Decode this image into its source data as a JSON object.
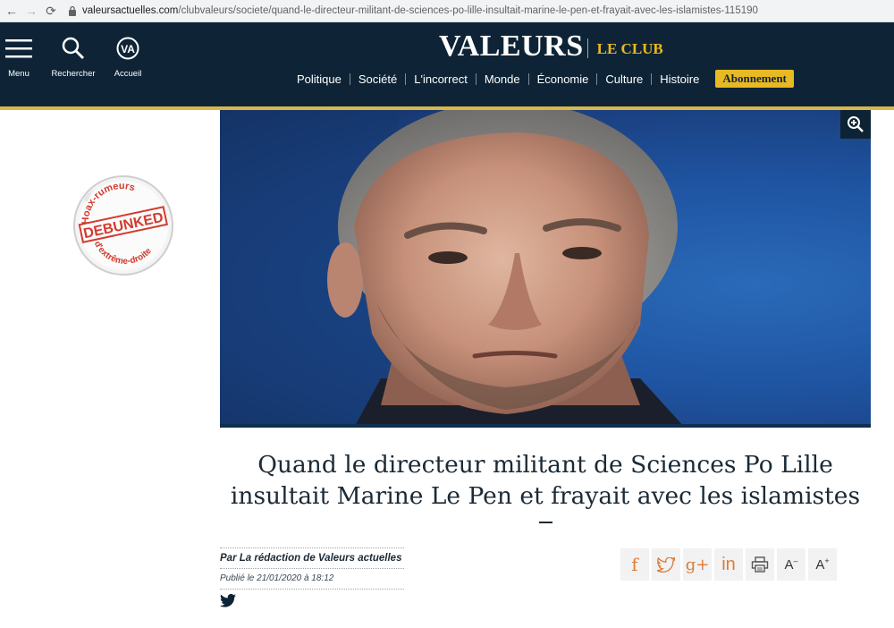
{
  "browser": {
    "url_host": "valeursactuelles.com",
    "url_path": "/clubvaleurs/societe/quand-le-directeur-militant-de-sciences-po-lille-insultait-marine-le-pen-et-frayait-avec-les-islamistes-115190"
  },
  "header": {
    "tools": [
      {
        "label": "Menu",
        "icon": "hamburger-icon"
      },
      {
        "label": "Rechercher",
        "icon": "search-icon"
      },
      {
        "label": "Accueil",
        "icon": "va-home-icon"
      }
    ],
    "logo": {
      "main": "VALEURS",
      "sub": "LE CLUB",
      "va_glyph": "VA"
    },
    "nav": [
      "Politique",
      "Société",
      "L'incorrect",
      "Monde",
      "Économie",
      "Culture",
      "Histoire"
    ],
    "subscribe": "Abonnement",
    "accent_color": "#e8b923",
    "background_color": "#0e2436"
  },
  "stamp": {
    "line_top": "Hoax-rumeurs",
    "line_middle": "DEBUNKED",
    "line_bottom": "d'extrême-droite",
    "color": "#d23b2e"
  },
  "hero": {
    "zoom_icon": "zoom-in-icon"
  },
  "article": {
    "title_line1": "Quand le directeur militant de Sciences Po Lille",
    "title_line2": "insultait Marine Le Pen et frayait avec les islamistes",
    "author": "Par La rédaction de Valeurs actuelles",
    "published": "Publié le 21/01/2020 à 18:12"
  },
  "share": {
    "buttons": [
      {
        "icon": "facebook-icon",
        "glyph": "f"
      },
      {
        "icon": "twitter-icon",
        "glyph": ""
      },
      {
        "icon": "google-plus-icon",
        "glyph": "g+"
      },
      {
        "icon": "linkedin-icon",
        "glyph": "in"
      },
      {
        "icon": "print-icon",
        "glyph": ""
      },
      {
        "icon": "font-decrease-icon",
        "glyph": "A",
        "sup": "–"
      },
      {
        "icon": "font-increase-icon",
        "glyph": "A",
        "sup": "+"
      }
    ]
  }
}
